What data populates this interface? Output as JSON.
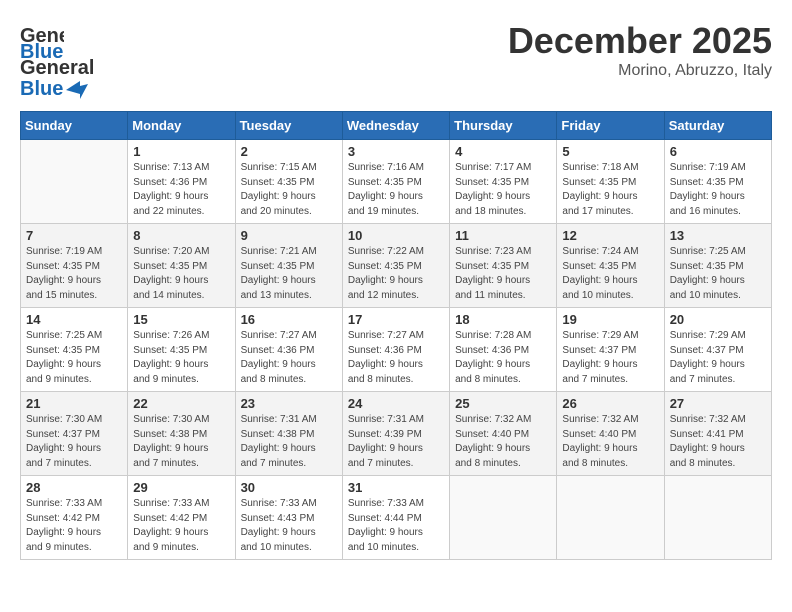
{
  "header": {
    "logo_line1": "General",
    "logo_line2": "Blue",
    "month": "December 2025",
    "location": "Morino, Abruzzo, Italy"
  },
  "weekdays": [
    "Sunday",
    "Monday",
    "Tuesday",
    "Wednesday",
    "Thursday",
    "Friday",
    "Saturday"
  ],
  "weeks": [
    [
      {
        "day": "",
        "info": ""
      },
      {
        "day": "1",
        "info": "Sunrise: 7:13 AM\nSunset: 4:36 PM\nDaylight: 9 hours\nand 22 minutes."
      },
      {
        "day": "2",
        "info": "Sunrise: 7:15 AM\nSunset: 4:35 PM\nDaylight: 9 hours\nand 20 minutes."
      },
      {
        "day": "3",
        "info": "Sunrise: 7:16 AM\nSunset: 4:35 PM\nDaylight: 9 hours\nand 19 minutes."
      },
      {
        "day": "4",
        "info": "Sunrise: 7:17 AM\nSunset: 4:35 PM\nDaylight: 9 hours\nand 18 minutes."
      },
      {
        "day": "5",
        "info": "Sunrise: 7:18 AM\nSunset: 4:35 PM\nDaylight: 9 hours\nand 17 minutes."
      },
      {
        "day": "6",
        "info": "Sunrise: 7:19 AM\nSunset: 4:35 PM\nDaylight: 9 hours\nand 16 minutes."
      }
    ],
    [
      {
        "day": "7",
        "info": "Sunrise: 7:19 AM\nSunset: 4:35 PM\nDaylight: 9 hours\nand 15 minutes."
      },
      {
        "day": "8",
        "info": "Sunrise: 7:20 AM\nSunset: 4:35 PM\nDaylight: 9 hours\nand 14 minutes."
      },
      {
        "day": "9",
        "info": "Sunrise: 7:21 AM\nSunset: 4:35 PM\nDaylight: 9 hours\nand 13 minutes."
      },
      {
        "day": "10",
        "info": "Sunrise: 7:22 AM\nSunset: 4:35 PM\nDaylight: 9 hours\nand 12 minutes."
      },
      {
        "day": "11",
        "info": "Sunrise: 7:23 AM\nSunset: 4:35 PM\nDaylight: 9 hours\nand 11 minutes."
      },
      {
        "day": "12",
        "info": "Sunrise: 7:24 AM\nSunset: 4:35 PM\nDaylight: 9 hours\nand 10 minutes."
      },
      {
        "day": "13",
        "info": "Sunrise: 7:25 AM\nSunset: 4:35 PM\nDaylight: 9 hours\nand 10 minutes."
      }
    ],
    [
      {
        "day": "14",
        "info": "Sunrise: 7:25 AM\nSunset: 4:35 PM\nDaylight: 9 hours\nand 9 minutes."
      },
      {
        "day": "15",
        "info": "Sunrise: 7:26 AM\nSunset: 4:35 PM\nDaylight: 9 hours\nand 9 minutes."
      },
      {
        "day": "16",
        "info": "Sunrise: 7:27 AM\nSunset: 4:36 PM\nDaylight: 9 hours\nand 8 minutes."
      },
      {
        "day": "17",
        "info": "Sunrise: 7:27 AM\nSunset: 4:36 PM\nDaylight: 9 hours\nand 8 minutes."
      },
      {
        "day": "18",
        "info": "Sunrise: 7:28 AM\nSunset: 4:36 PM\nDaylight: 9 hours\nand 8 minutes."
      },
      {
        "day": "19",
        "info": "Sunrise: 7:29 AM\nSunset: 4:37 PM\nDaylight: 9 hours\nand 7 minutes."
      },
      {
        "day": "20",
        "info": "Sunrise: 7:29 AM\nSunset: 4:37 PM\nDaylight: 9 hours\nand 7 minutes."
      }
    ],
    [
      {
        "day": "21",
        "info": "Sunrise: 7:30 AM\nSunset: 4:37 PM\nDaylight: 9 hours\nand 7 minutes."
      },
      {
        "day": "22",
        "info": "Sunrise: 7:30 AM\nSunset: 4:38 PM\nDaylight: 9 hours\nand 7 minutes."
      },
      {
        "day": "23",
        "info": "Sunrise: 7:31 AM\nSunset: 4:38 PM\nDaylight: 9 hours\nand 7 minutes."
      },
      {
        "day": "24",
        "info": "Sunrise: 7:31 AM\nSunset: 4:39 PM\nDaylight: 9 hours\nand 7 minutes."
      },
      {
        "day": "25",
        "info": "Sunrise: 7:32 AM\nSunset: 4:40 PM\nDaylight: 9 hours\nand 8 minutes."
      },
      {
        "day": "26",
        "info": "Sunrise: 7:32 AM\nSunset: 4:40 PM\nDaylight: 9 hours\nand 8 minutes."
      },
      {
        "day": "27",
        "info": "Sunrise: 7:32 AM\nSunset: 4:41 PM\nDaylight: 9 hours\nand 8 minutes."
      }
    ],
    [
      {
        "day": "28",
        "info": "Sunrise: 7:33 AM\nSunset: 4:42 PM\nDaylight: 9 hours\nand 9 minutes."
      },
      {
        "day": "29",
        "info": "Sunrise: 7:33 AM\nSunset: 4:42 PM\nDaylight: 9 hours\nand 9 minutes."
      },
      {
        "day": "30",
        "info": "Sunrise: 7:33 AM\nSunset: 4:43 PM\nDaylight: 9 hours\nand 10 minutes."
      },
      {
        "day": "31",
        "info": "Sunrise: 7:33 AM\nSunset: 4:44 PM\nDaylight: 9 hours\nand 10 minutes."
      },
      {
        "day": "",
        "info": ""
      },
      {
        "day": "",
        "info": ""
      },
      {
        "day": "",
        "info": ""
      }
    ]
  ]
}
